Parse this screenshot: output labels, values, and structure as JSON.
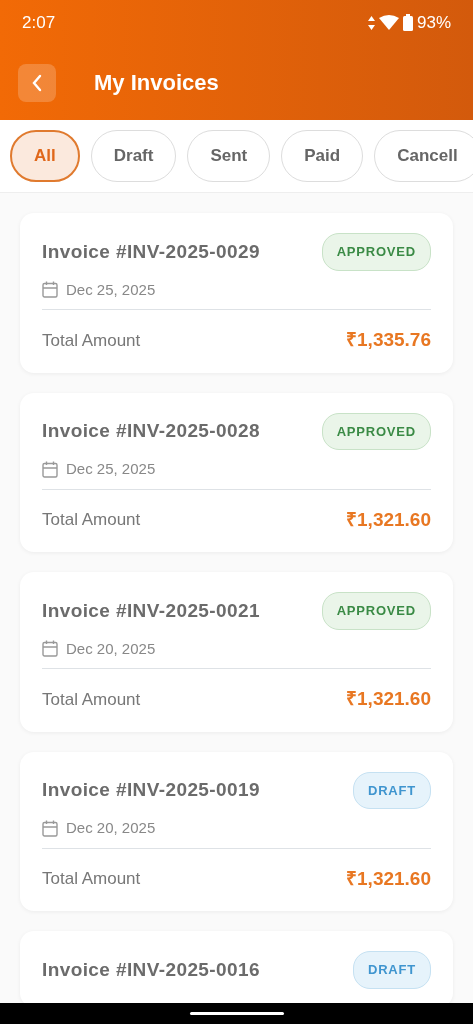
{
  "status_bar": {
    "time": "2:07",
    "battery": "93%"
  },
  "header": {
    "title": "My Invoices"
  },
  "filters": [
    {
      "label": "All",
      "selected": true
    },
    {
      "label": "Draft",
      "selected": false
    },
    {
      "label": "Sent",
      "selected": false
    },
    {
      "label": "Paid",
      "selected": false
    },
    {
      "label": "Cancell",
      "selected": false
    }
  ],
  "invoices": [
    {
      "number": "Invoice #INV-2025-0029",
      "status": "APPROVED",
      "kind": "approved",
      "date": "Dec 25, 2025",
      "amount_label": "Total Amount",
      "amount": "₹1,335.76"
    },
    {
      "number": "Invoice #INV-2025-0028",
      "status": "APPROVED",
      "kind": "approved",
      "date": "Dec 25, 2025",
      "amount_label": "Total Amount",
      "amount": "₹1,321.60"
    },
    {
      "number": "Invoice #INV-2025-0021",
      "status": "APPROVED",
      "kind": "approved",
      "date": "Dec 20, 2025",
      "amount_label": "Total Amount",
      "amount": "₹1,321.60"
    },
    {
      "number": "Invoice #INV-2025-0019",
      "status": "DRAFT",
      "kind": "draft",
      "date": "Dec 20, 2025",
      "amount_label": "Total Amount",
      "amount": "₹1,321.60"
    },
    {
      "number": "Invoice #INV-2025-0016",
      "status": "DRAFT",
      "kind": "draft"
    }
  ]
}
